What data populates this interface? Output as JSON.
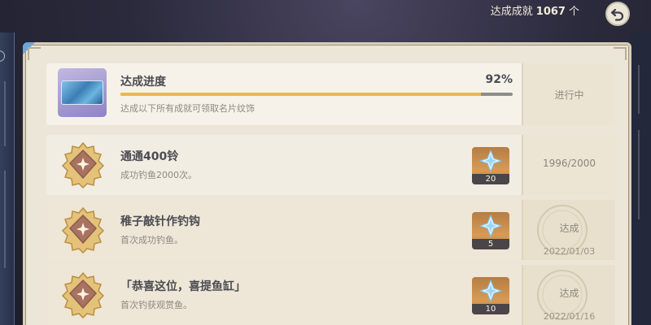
{
  "header": {
    "achieved_label": "达成成就",
    "achieved_count": "1067",
    "achieved_unit": "个",
    "back_icon": "back-arrow-icon"
  },
  "progress": {
    "title": "达成进度",
    "percent_text": "92%",
    "percent": 92,
    "description": "达成以下所有成就可领取名片纹饰",
    "status": "进行中",
    "accent_color": "#e9b94d"
  },
  "achievements": [
    {
      "title": "通通400铃",
      "description": "成功钓鱼2000次。",
      "reward_count": "20",
      "reward_icon": "primogem-icon",
      "progress": "1996/2000",
      "completed": false
    },
    {
      "title": "稚子敲针作钓钩",
      "description": "首次成功钓鱼。",
      "reward_count": "5",
      "reward_icon": "primogem-icon",
      "status": "达成",
      "date": "2022/01/03",
      "completed": true
    },
    {
      "title": "「恭喜这位，喜提鱼缸」",
      "description": "首次钓获观赏鱼。",
      "reward_count": "10",
      "reward_icon": "primogem-icon",
      "status": "达成",
      "date": "2022/01/16",
      "completed": true
    }
  ]
}
